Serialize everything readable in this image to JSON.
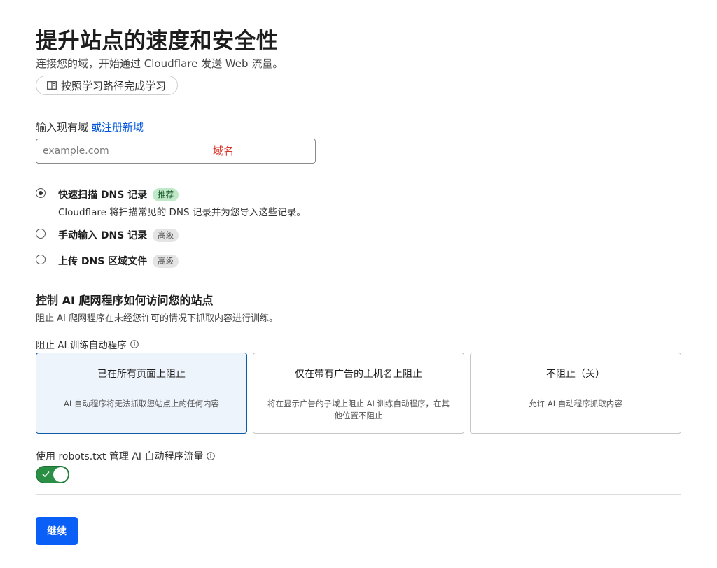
{
  "header": {
    "title": "提升站点的速度和安全性",
    "subtitle": "连接您的域，开始通过 Cloudflare 发送 Web 流量。",
    "learn_button": "按照学习路径完成学习"
  },
  "domain": {
    "label": "输入现有域",
    "register_link": "或注册新域",
    "placeholder": "example.com",
    "annotation": "域名"
  },
  "dns_options": [
    {
      "title": "快速扫描 DNS 记录",
      "badge": "推荐",
      "description": "Cloudflare 将扫描常见的 DNS 记录并为您导入这些记录。",
      "selected": true
    },
    {
      "title": "手动输入 DNS 记录",
      "badge": "高级",
      "selected": false
    },
    {
      "title": "上传 DNS 区域文件",
      "badge": "高级",
      "selected": false
    }
  ],
  "ai_section": {
    "title": "控制 AI 爬网程序如何访问您的站点",
    "description": "阻止 AI 爬网程序在未经您许可的情况下抓取内容进行训练。",
    "block_label": "阻止 AI 训练自动程序",
    "cards": [
      {
        "title": "已在所有页面上阻止",
        "description": "AI 自动程序将无法抓取您站点上的任何内容",
        "selected": true
      },
      {
        "title": "仅在带有广告的主机名上阻止",
        "description": "将在显示广告的子域上阻止 AI 训练自动程序，在其他位置不阻止",
        "selected": false
      },
      {
        "title": "不阻止（关）",
        "description": "允许 AI 自动程序抓取内容",
        "selected": false
      }
    ],
    "robots_label": "使用 robots.txt 管理 AI 自动程序流量",
    "robots_enabled": true
  },
  "footer": {
    "continue_label": "继续"
  },
  "colors": {
    "accent": "#0a5ff7",
    "link": "#0055dc",
    "toggle_on": "#2a8f45",
    "annotation": "#d9362b",
    "selected_card_bg": "#eef4fc"
  },
  "icons": {
    "learn_button": "book-icon",
    "info": "info-icon",
    "toggle": "check-icon"
  }
}
